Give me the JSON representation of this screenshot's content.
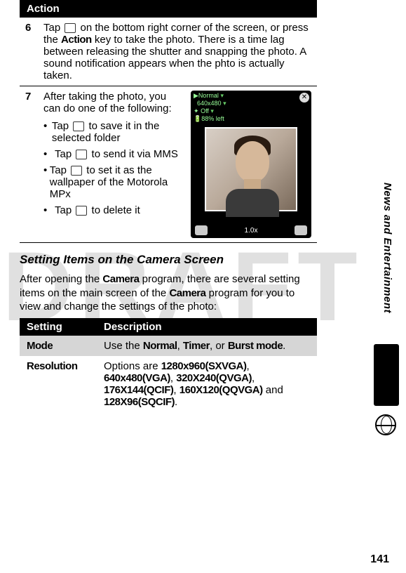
{
  "action_header": "Action",
  "step6": {
    "num": "6",
    "text_before_icon": "Tap ",
    "text_after_icon": " on the bottom right corner of the screen, or press the ",
    "action_key": "Action",
    "text_rest": " key to take the photo. There is a time lag between releasing the shutter and snapping the photo. A sound notification appears when the phto is actually taken."
  },
  "step7": {
    "num": "7",
    "intro": "After taking the photo, you can do one of the following:",
    "b1_a": "Tap ",
    "b1_b": " to save it in the selected folder",
    "b2_a": "Tap ",
    "b2_b": " to send it via MMS",
    "b3_a": "Tap ",
    "b3_b": " to set it as the wallpaper of the Motorola MPx",
    "b4_a": "Tap ",
    "b4_b": " to delete it"
  },
  "phone": {
    "line1": "Normal",
    "line2": "640x480",
    "line3": "Off",
    "line4": "88% left",
    "close": "✕",
    "zoom": "1.0x"
  },
  "subhead": "Setting Items on the Camera Screen",
  "para_a": "After opening the ",
  "camera_word": "Camera",
  "para_b": " program, there are several setting items on the main screen of the ",
  "para_c": " program for you to view and change the settings of the photo:",
  "settings_header": {
    "c1": "Setting",
    "c2": "Description"
  },
  "row_mode": {
    "label": "Mode",
    "pre": "Use the ",
    "v1": "Normal",
    "sep1": ", ",
    "v2": "Timer",
    "sep2": ", or ",
    "v3": "Burst mode",
    "post": "."
  },
  "row_res": {
    "label": "Resolution",
    "pre": "Options are ",
    "v1": "1280x960(SXVGA)",
    "s1": ", ",
    "v2": "640x480(VGA)",
    "s2": ", ",
    "v3": "320X240(QVGA)",
    "s3": ", ",
    "v4": "176X144(QCIF)",
    "s4": ", ",
    "v5": "160X120(QQVGA)",
    "s5": " and ",
    "v6": "128X96(SQCIF)",
    "post": "."
  },
  "sidebar": "News and Entertainment",
  "pagenum": "141"
}
